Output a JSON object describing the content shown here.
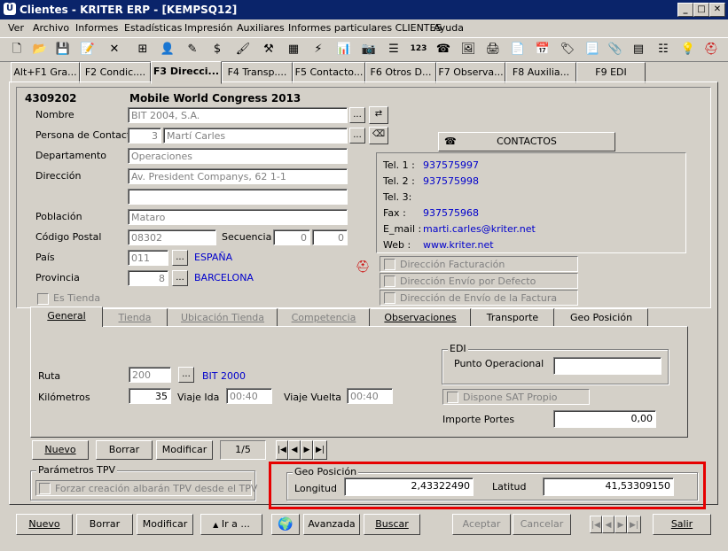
{
  "window": {
    "title": "Clientes - KRITER ERP - [KEMPSQ12]",
    "app_icon_glyph": "Ü"
  },
  "window_controls": {
    "minimize": "_",
    "maximize": "□",
    "close": "✕"
  },
  "menu": [
    "Ver",
    "Archivo",
    "Informes",
    "Estadísticas",
    "Impresión",
    "Auxiliares",
    "Informes particulares CLIENTES",
    "Ayuda"
  ],
  "toolbar_icons": [
    "new-doc",
    "open-folder",
    "save",
    "edit",
    "delete-x",
    "tree",
    "search-person",
    "edit-pencil",
    "money",
    "paint",
    "hammer",
    "grid",
    "lightning",
    "copy",
    "chart-bars",
    "camera",
    "list-view",
    "calculator-123",
    "phone",
    "photo",
    "print-red",
    "calendar",
    "tag",
    "document",
    "paperclip",
    "table-grid",
    "bullet-list",
    "bulb",
    "exit-red"
  ],
  "function_tabs": [
    "Alt+F1 Gra...",
    "F2 Condic....",
    "F3 Direcci...",
    "F4 Transp....",
    "F5 Contacto...",
    "F6 Otros D...",
    "F7 Observa...",
    "F8 Auxilia...",
    "F9 EDI"
  ],
  "header": {
    "code": "4309202",
    "name": "Mobile World Congress 2013"
  },
  "form": {
    "nombre_label": "Nombre",
    "nombre": "BIT 2004, S.A.",
    "contacto_label": "Persona de Contacto",
    "contacto_num": "3",
    "contacto": "Martí Carles",
    "departamento_label": "Departamento",
    "departamento": "Operaciones",
    "direccion_label": "Dirección",
    "direccion": "Av. President Companys, 62 1-1",
    "direccion2": "",
    "poblacion_label": "Población",
    "poblacion": "Mataro",
    "cp_label": "Código Postal",
    "cp": "08302",
    "secuencia_label": "Secuencia",
    "secuencia1": "0",
    "secuencia2": "0",
    "pais_label": "País",
    "pais_code": "011",
    "pais_name": "ESPAÑA",
    "provincia_label": "Provincia",
    "provincia_code": "8",
    "provincia_name": "BARCELONA",
    "es_tienda": "Es Tienda"
  },
  "contactos": {
    "button": "CONTACTOS",
    "tel1_label": "Tel. 1 :",
    "tel1": "937575997",
    "tel2_label": "Tel. 2 :",
    "tel2": "937575998",
    "tel3_label": "Tel. 3:",
    "tel3": "",
    "fax_label": "Fax :",
    "fax": "937575968",
    "email_label": "E_mail :",
    "email": "marti.carles@kriter.net",
    "web_label": "Web :",
    "web": "www.kriter.net"
  },
  "checks": [
    "Dirección Facturación",
    "Dirección Envío por Defecto",
    "Dirección de Envío de la Factura"
  ],
  "inner_tabs": [
    {
      "label": "General",
      "state": "active"
    },
    {
      "label": "Tienda",
      "state": "disabled"
    },
    {
      "label": "Ubicación Tienda",
      "state": "disabled"
    },
    {
      "label": "Competencia",
      "state": "disabled"
    },
    {
      "label": "Observaciones",
      "state": "enabled"
    },
    {
      "label": "Transporte",
      "state": "enabled"
    },
    {
      "label": "Geo Posición",
      "state": "enabled"
    }
  ],
  "general": {
    "ruta_label": "Ruta",
    "ruta": "200",
    "ruta_name": "BIT 2000",
    "km_label": "Kilómetros",
    "km": "35",
    "ida_label": "Viaje Ida",
    "ida": "00:40",
    "vuelta_label": "Viaje Vuelta",
    "vuelta": "00:40",
    "edi_title": "EDI",
    "punto_label": "Punto Operacional",
    "punto": "",
    "sat_label": "Dispone SAT Propio",
    "portes_label": "Importe Portes",
    "portes": "0,00"
  },
  "inner_buttons": {
    "nuevo": "Nuevo",
    "borrar": "Borrar",
    "modificar": "Modificar",
    "counter": "1/5"
  },
  "tpv": {
    "title": "Parámetros TPV",
    "check": "Forzar creación albarán TPV desde el TPV"
  },
  "geo": {
    "title": "Geo Posición",
    "longitud_label": "Longitud",
    "longitud": "2,43322490",
    "latitud_label": "Latitud",
    "latitud": "41,53309150"
  },
  "bottom": {
    "nuevo": "Nuevo",
    "borrar": "Borrar",
    "modificar": "Modificar",
    "ira": "Ir a ...",
    "avanzada": "Avanzada",
    "buscar": "Buscar",
    "aceptar": "Aceptar",
    "cancelar": "Cancelar",
    "salir": "Salir"
  },
  "nav_glyphs": {
    "first": "|◀",
    "prev": "◀",
    "next": "▶",
    "last": "▶|"
  },
  "colors": {
    "highlight_box": "#e60000",
    "link_blue": "#0000cc",
    "titlebar": "#0a246a"
  }
}
